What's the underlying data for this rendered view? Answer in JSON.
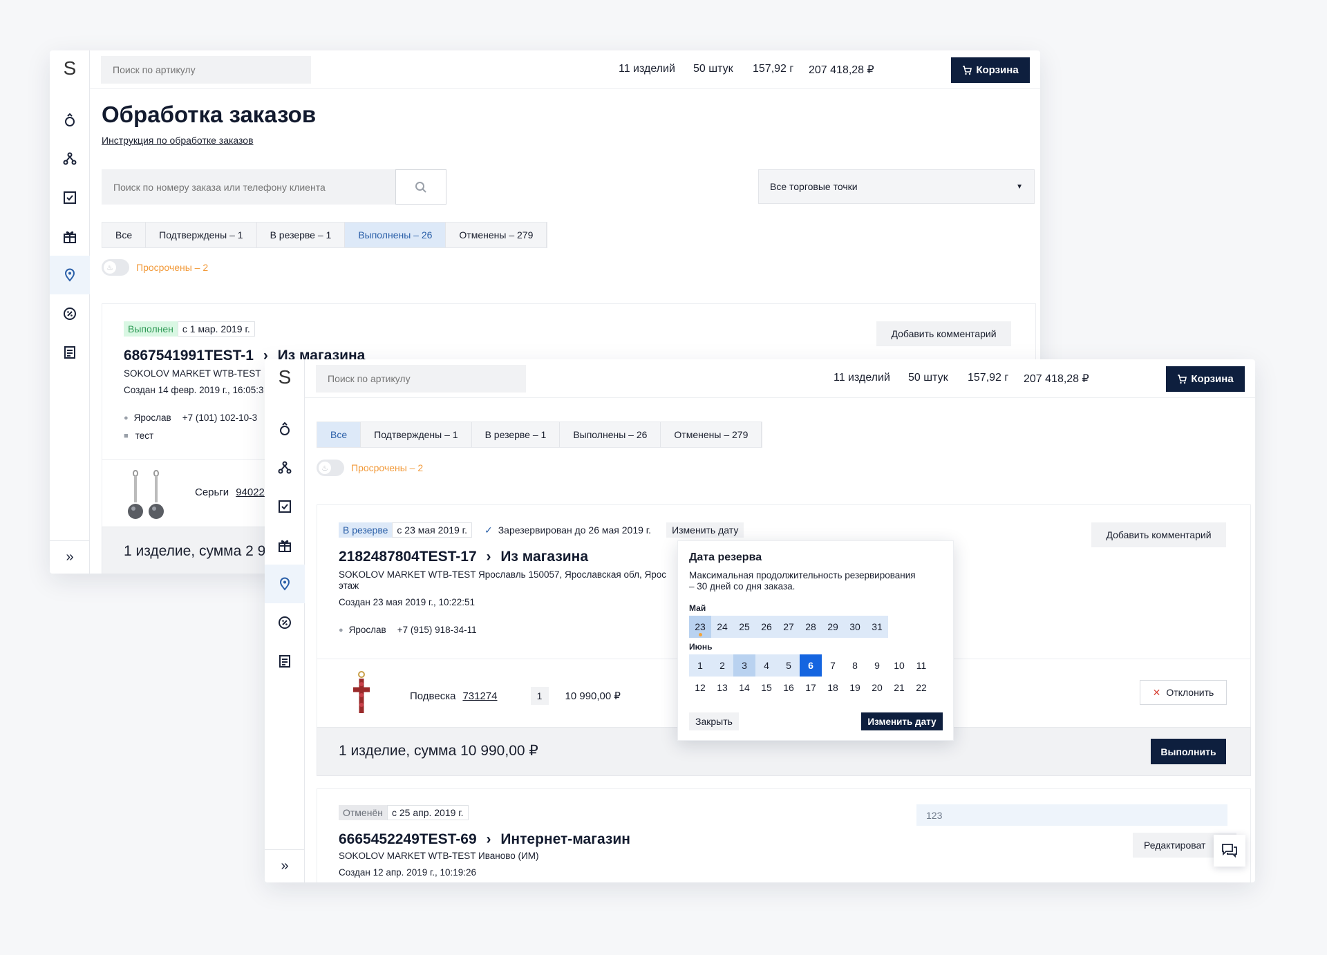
{
  "app": {
    "logo": "S"
  },
  "sidebar": {
    "items": [
      {
        "icon": "ring-icon"
      },
      {
        "icon": "pendant-icon"
      },
      {
        "icon": "checklist-icon"
      },
      {
        "icon": "gift-icon"
      },
      {
        "icon": "location-pin-icon"
      },
      {
        "icon": "discount-icon"
      },
      {
        "icon": "document-icon"
      }
    ],
    "expand": "»"
  },
  "header": {
    "search_placeholder": "Поиск по артикулу",
    "items_count": "11 изделий",
    "pieces": "50 штук",
    "weight": "157,92 г",
    "total": "207 418,28 ₽",
    "cart_label": "Корзина"
  },
  "page": {
    "title": "Обработка заказов",
    "instruction_link": "Инструкция по обработке заказов",
    "order_search_placeholder": "Поиск по номеру заказа или телефону клиента",
    "outlet_select": "Все торговые точки",
    "tabs": [
      "Все",
      "Подтверждены – 1",
      "В резерве – 1",
      "Выполнены – 26",
      "Отменены – 279"
    ],
    "overdue": "Просрочены – 2"
  },
  "winA": {
    "active_tab": "Выполнены – 26",
    "order": {
      "status": "Выполнен",
      "since": "с 1 мар. 2019 г.",
      "number": "6867541991TEST-1",
      "source": "Из магазина",
      "store": "SOKOLOV MARKET WTB-TEST",
      "created": "Создан 14 февр. 2019 г., 16:05:3",
      "customer": "Ярослав",
      "phone": "+7 (101) 102-10-3",
      "comment": "тест",
      "add_comment": "Добавить комментарий",
      "item_name": "Серьги",
      "item_article": "94022",
      "summary": "1 изделие, сумма 2 99"
    }
  },
  "winB": {
    "active_tab": "Все",
    "order1": {
      "status": "В резерве",
      "since": "с 23 мая 2019 г.",
      "reserved_until": "Зарезервирован до 26 мая 2019 г.",
      "change_date": "Изменить дату",
      "number": "2182487804TEST-17",
      "source": "Из магазина",
      "store_address": "SOKOLOV MARKET WTB-TEST Ярославль 150057, Ярославская обл, Ярос",
      "store_address_2": "этаж",
      "created": "Создан 23 мая 2019 г., 10:22:51",
      "customer": "Ярослав",
      "phone": "+7 (915) 918-34-11",
      "add_comment": "Добавить комментарий",
      "item_name": "Подвеска",
      "item_article": "731274",
      "item_qty": "1",
      "item_price": "10 990,00 ₽",
      "reject": "Отклонить",
      "summary": "1 изделие, сумма 10 990,00 ₽",
      "complete": "Выполнить"
    },
    "order2": {
      "status": "Отменён",
      "since": "с 25 апр. 2019 г.",
      "number": "6665452249TEST-69",
      "source": "Интернет-магазин",
      "store": "SOKOLOV MARKET WTB-TEST Иваново (ИМ)",
      "created": "Создан 12 апр. 2019 г., 10:19:26",
      "comment_value": "123",
      "edit": "Редактироват"
    }
  },
  "date_popup": {
    "title": "Дата резерва",
    "description_1": "Максимальная продолжительность резервирования",
    "description_2": "– 30 дней со дня заказа.",
    "month_1": "Май",
    "month_1_days": [
      "23",
      "24",
      "25",
      "26",
      "27",
      "28",
      "29",
      "30",
      "31"
    ],
    "month_2": "Июнь",
    "month_2_row1": [
      "1",
      "2",
      "3",
      "4",
      "5",
      "6",
      "7",
      "8",
      "9",
      "10",
      "11"
    ],
    "month_2_row2": [
      "12",
      "13",
      "14",
      "15",
      "16",
      "17",
      "18",
      "19",
      "20",
      "21",
      "22"
    ],
    "selected_day": "6",
    "close": "Закрыть",
    "apply": "Изменить дату"
  },
  "colors": {
    "navy": "#0e1f3e",
    "accent_blue": "#1565e0",
    "done_green": "#2e9a55",
    "overdue_orange": "#f29a3a"
  }
}
